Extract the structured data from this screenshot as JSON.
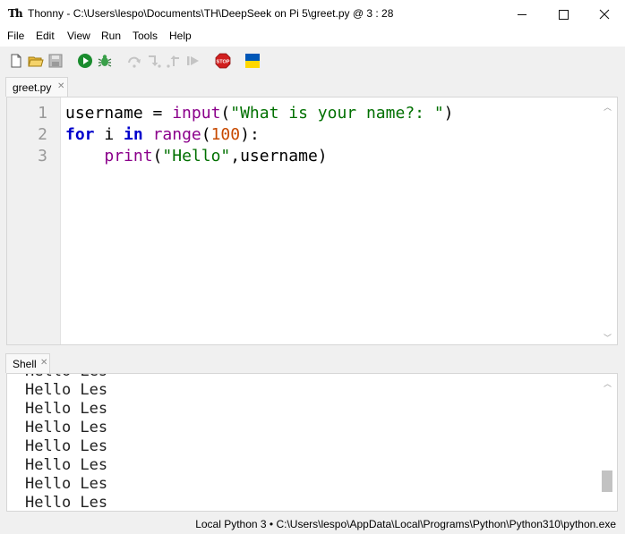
{
  "window": {
    "logo_text": "Th",
    "title": "Thonny  -  C:\\Users\\lespo\\Documents\\TH\\DeepSeek on Pi 5\\greet.py  @  3 : 28"
  },
  "menu": [
    "File",
    "Edit",
    "View",
    "Run",
    "Tools",
    "Help"
  ],
  "toolbar": {
    "icons": [
      "new-file-icon",
      "open-folder-icon",
      "save-icon",
      "run-icon",
      "debug-icon",
      "step-over-icon",
      "step-into-icon",
      "step-out-icon",
      "resume-icon",
      "stop-icon",
      "ukraine-flag-icon"
    ],
    "stop_label": "STOP",
    "colors": {
      "run": "#1a8c2e",
      "stop": "#d11f1f",
      "flag_blue": "#0057b7",
      "flag_yellow": "#ffd700"
    }
  },
  "editor": {
    "tab_label": "greet.py",
    "line_numbers": [
      "1",
      "2",
      "3"
    ],
    "code": [
      "username = input(\"What is your name?: \")",
      "for i in range(100):",
      "    print(\"Hello\",username)"
    ]
  },
  "shell": {
    "tab_label": "Shell",
    "partial_line": "Hello Les",
    "lines": [
      "Hello Les",
      "Hello Les",
      "Hello Les",
      "Hello Les",
      "Hello Les",
      "Hello Les",
      "Hello Les"
    ]
  },
  "status": {
    "text": "Local Python 3  •  C:\\Users\\lespo\\AppData\\Local\\Programs\\Python\\Python310\\python.exe"
  }
}
